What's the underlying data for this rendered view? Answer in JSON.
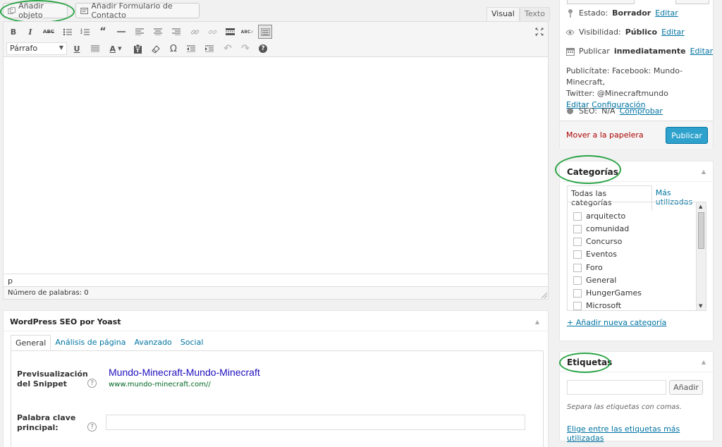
{
  "editor": {
    "add_media": "Añadir objeto",
    "add_form": "Añadir Formulario de Contacto",
    "tab_visual": "Visual",
    "tab_text": "Texto",
    "format_value": "Párrafo",
    "path": "p",
    "word_count": "Número de palabras: 0"
  },
  "seo": {
    "title": "WordPress SEO por Yoast",
    "tabs": [
      "General",
      "Análisis de página",
      "Avanzado",
      "Social"
    ],
    "snippet_label": "Previsualización del Snippet",
    "snippet_title": "Mundo-Minecraft-Mundo-Minecraft",
    "snippet_url": "www.mundo-minecraft.com//",
    "keyword_label": "Palabra clave principal:",
    "help": "?"
  },
  "publish": {
    "status_label": "Estado:",
    "status_value": "Borrador",
    "visibility_label": "Visibilidad:",
    "visibility_value": "Público",
    "schedule_label": "Publicar",
    "schedule_value": "inmediatamente",
    "edit": "Editar",
    "publicize_line1": "Publicítate: Facebook: Mundo-Minecraft,",
    "publicize_line2": "Twitter: @Minecraftmundo",
    "publicize_edit": "Editar",
    "publicize_config": "Configuración",
    "seo_label": "SEO:",
    "seo_value": "N/A",
    "seo_check": "Comprobar",
    "trash": "Mover a la papelera",
    "publish_button": "Publicar"
  },
  "categories": {
    "title": "Categorías",
    "tab_all": "Todas las categorías",
    "tab_popular": "Más utilizadas",
    "items": [
      "arquitecto",
      "comunidad",
      "Concurso",
      "Eventos",
      "Foro",
      "General",
      "HungerGames",
      "Microsoft"
    ],
    "add_new": "+ Añadir nueva categoría"
  },
  "tags": {
    "title": "Etiquetas",
    "add_button": "Añadir",
    "hint": "Separa las etiquetas con comas.",
    "choose": "Elige entre las etiquetas más utilizadas"
  },
  "colors": {
    "accent": "#0074a2",
    "publish": "#2ea2cc",
    "trash": "#a00",
    "highlight": "#2aa446",
    "snippet_title": "#1e0fbe",
    "snippet_url": "#006621"
  }
}
